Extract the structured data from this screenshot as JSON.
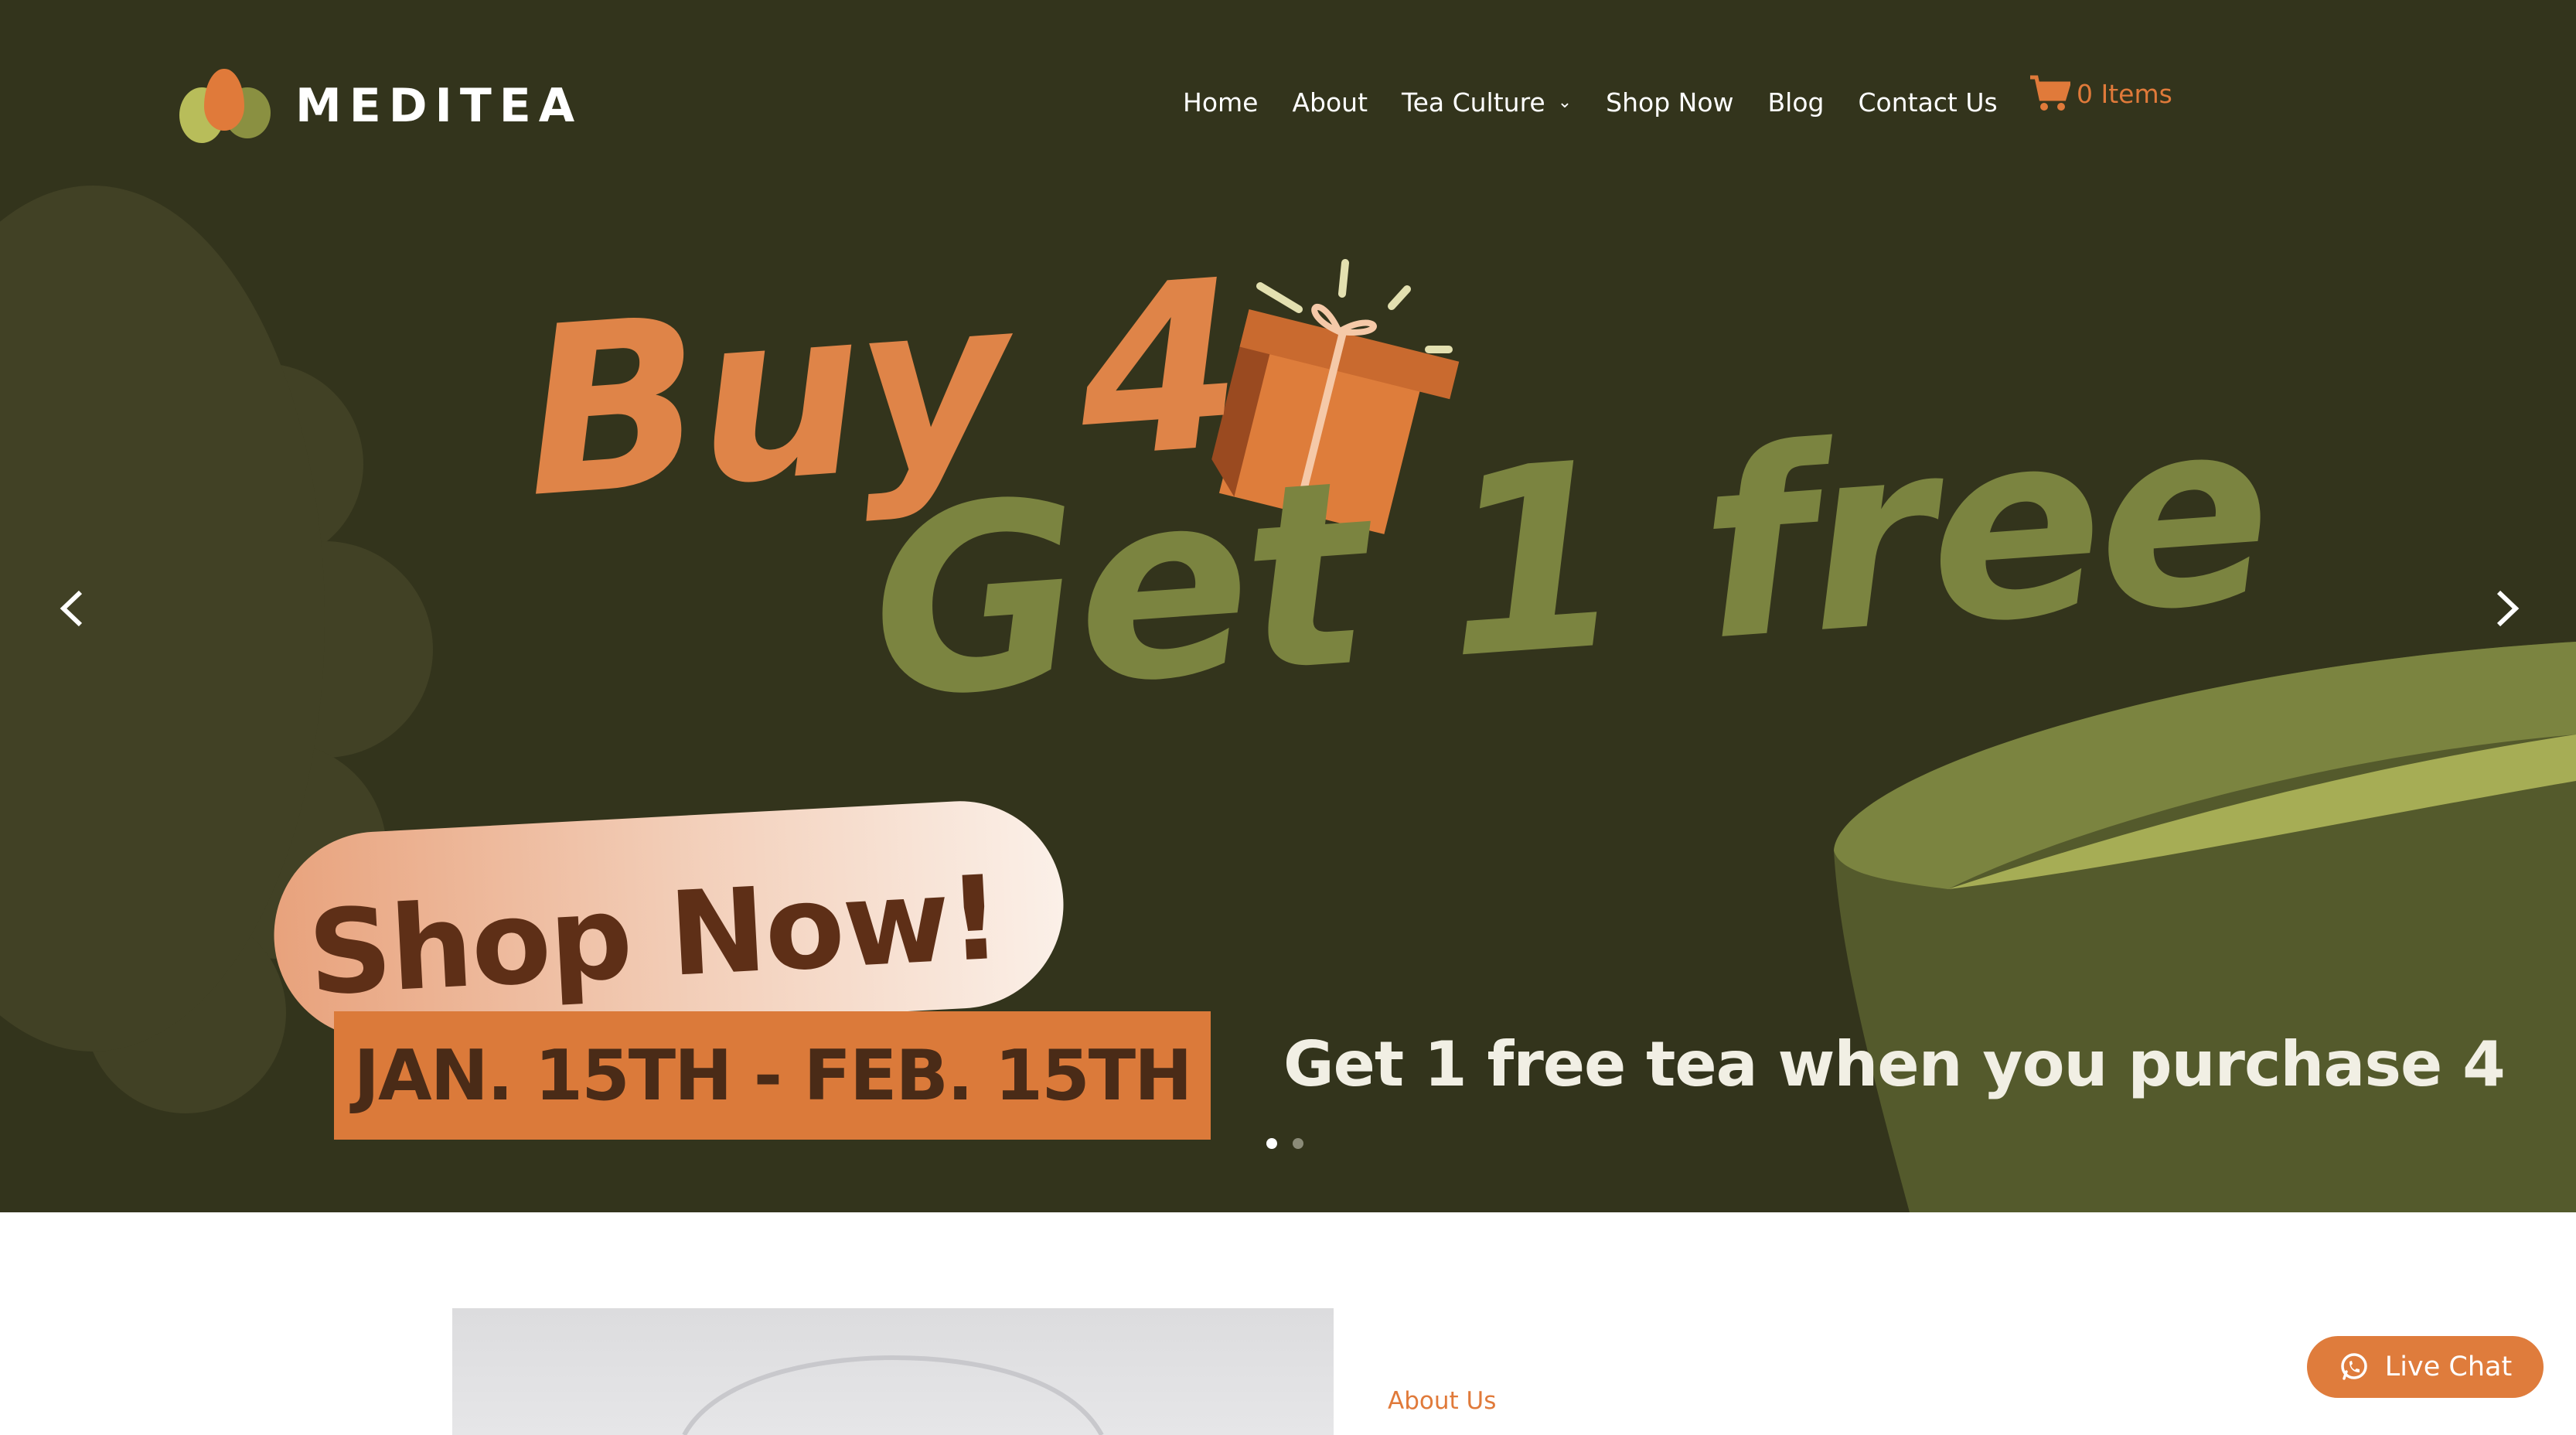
{
  "brand": {
    "name": "MEDITEA"
  },
  "nav": {
    "items": [
      {
        "label": "Home"
      },
      {
        "label": "About"
      },
      {
        "label": "Tea Culture",
        "has_dropdown": true
      },
      {
        "label": "Shop Now"
      },
      {
        "label": "Blog"
      },
      {
        "label": "Contact Us"
      }
    ],
    "cart_label": "0 Items"
  },
  "hero": {
    "headline_1": "Buy 4",
    "headline_2": "Get 1 free",
    "cta_label": "Shop Now!",
    "date_range": "JAN. 15TH - FEB. 15TH",
    "tagline": "Get 1 free tea when you purchase 4",
    "slides_total": 2,
    "active_slide": 1
  },
  "about": {
    "label": "About Us"
  },
  "live_chat": {
    "label": "Live Chat"
  },
  "icons": {
    "cart": "cart-icon",
    "prev": "chevron-left-icon",
    "next": "chevron-right-icon",
    "dropdown": "chevron-down-icon",
    "chat": "whatsapp-icon",
    "gift": "gift-icon"
  },
  "colors": {
    "hero_bg": "#33341c",
    "accent_orange": "#df7c3c",
    "olive": "#7b8440",
    "cta_text": "#5e2f17"
  }
}
